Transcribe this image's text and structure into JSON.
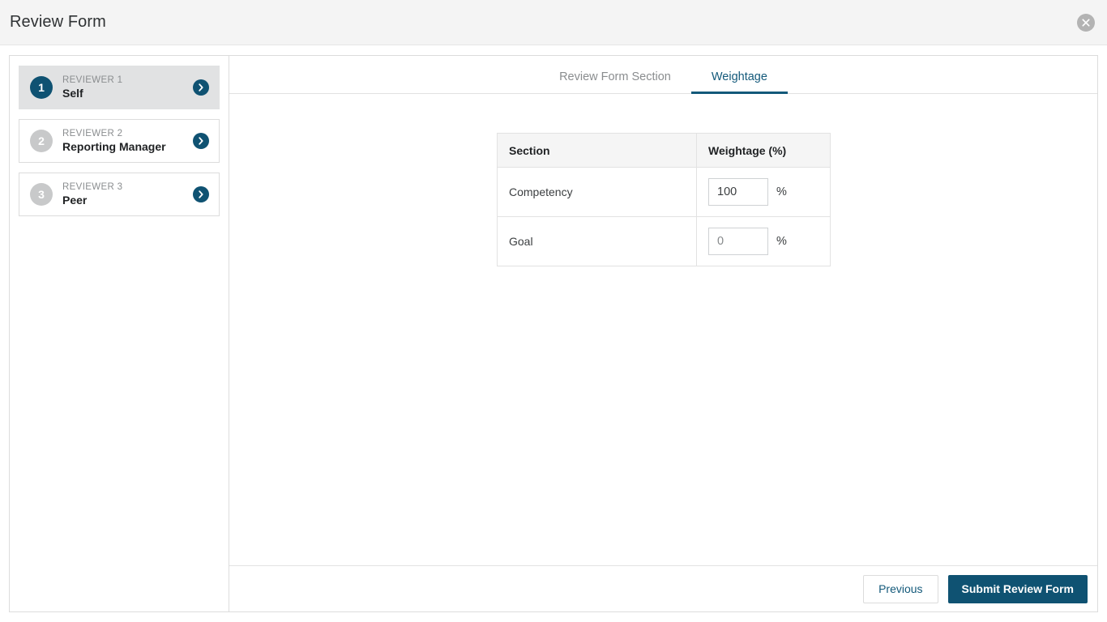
{
  "window": {
    "title": "Review Form",
    "close_icon": "close-circle-icon"
  },
  "sidebar": {
    "items": [
      {
        "number": "1",
        "role": "REVIEWER 1",
        "name": "Self",
        "active": true,
        "chevron_icon": "chevron-right-icon"
      },
      {
        "number": "2",
        "role": "REVIEWER 2",
        "name": "Reporting Manager",
        "active": false,
        "chevron_icon": "chevron-right-icon"
      },
      {
        "number": "3",
        "role": "REVIEWER 3",
        "name": "Peer",
        "active": false,
        "chevron_icon": "chevron-right-icon"
      }
    ]
  },
  "tabs": [
    {
      "label": "Review Form Section",
      "active": false
    },
    {
      "label": "Weightage",
      "active": true
    }
  ],
  "table": {
    "headers": [
      "Section",
      "Weightage (%)"
    ],
    "rows": [
      {
        "section": "Competency",
        "value": "100",
        "unit": "%",
        "muted": false
      },
      {
        "section": "Goal",
        "value": "0",
        "unit": "%",
        "muted": true
      }
    ]
  },
  "footer": {
    "previous_label": "Previous",
    "submit_label": "Submit Review Form"
  },
  "colors": {
    "accent": "#0f5272",
    "tab_active": "#13597a",
    "selected_row_bg": "#e1e2e3",
    "header_bg": "#f4f4f4",
    "border": "#dcdcdc"
  }
}
